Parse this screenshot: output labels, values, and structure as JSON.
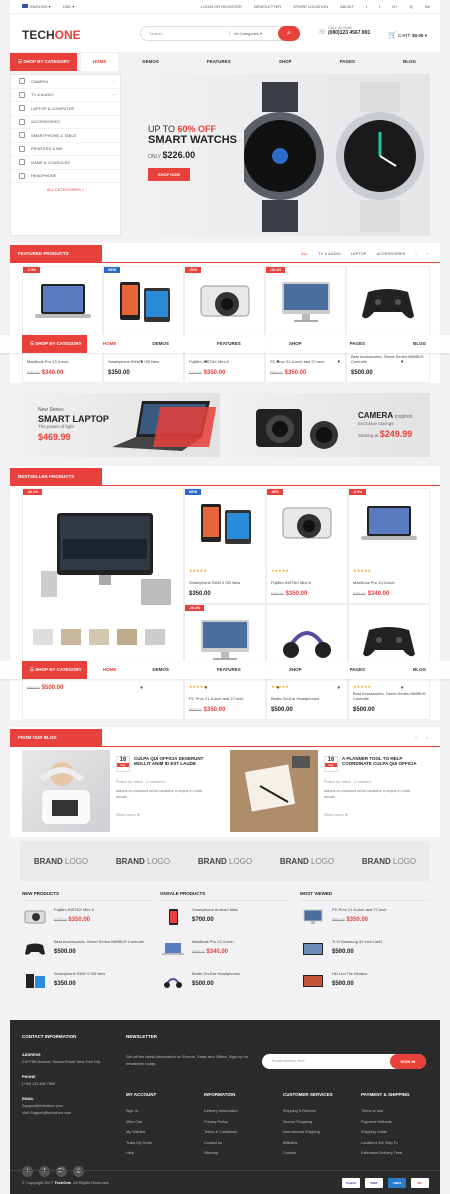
{
  "topbar": {
    "language": "ENGLISH",
    "currency": "USD",
    "links": [
      "LOGIN OR REGISTER",
      "NEWSLETTER",
      "STORE LOCATION",
      "ABOUT"
    ],
    "social_icons": [
      "twitter-icon",
      "facebook-icon",
      "google-plus-icon",
      "dribbble-icon",
      "behance-icon"
    ]
  },
  "header": {
    "logo_a": "TECH",
    "logo_b": "ONE",
    "search_placeholder": "Search...",
    "search_category": "All Categories",
    "call_label": "CALL US NOW",
    "phone": "(080)123 4567 891",
    "cart_label": "CART:",
    "cart_total": "$0.00"
  },
  "nav": {
    "category_label": "SHOP BY CATEGORY",
    "items": [
      "HOME",
      "DEMOS",
      "FEATURES",
      "SHOP",
      "PAGES",
      "BLOG"
    ]
  },
  "categories": [
    "CAMERA",
    "TV & AUDIO",
    "LAPTOP & COMPUTER",
    "ACCESSORIES",
    "SMARTPHONE & TABLE",
    "PRINTERS & INK",
    "GAME & CONSOLES",
    "HEADPHONE"
  ],
  "all_categories": "ALL CATEGORIES",
  "banner": {
    "upto": "UP TO",
    "discount": "60% OFF",
    "title": "SMART WATCHS",
    "only": "ONLY",
    "price": "$226.00",
    "button": "SHOP NOW"
  },
  "featured": {
    "title": "FEATURED PRODUCTS",
    "tabs": [
      "ALL",
      "TV & AUDIO",
      "LAPTOP",
      "ACCESSORIES"
    ],
    "products": [
      {
        "badge": "-2.9%",
        "badge_type": "sale",
        "name": "MacBook Pro 13.3-inch",
        "old": "$350.00",
        "price": "$340.00"
      },
      {
        "badge": "NEW",
        "badge_type": "new",
        "name": "Smartphone RAM 4 GB New",
        "old": "",
        "price": "$350.00"
      },
      {
        "badge": "-50%",
        "badge_type": "sale",
        "name": "Fujifilm INSTAX Mini 8",
        "old": "$700.00",
        "price": "$350.00"
      },
      {
        "badge": "-36.4%",
        "badge_type": "sale",
        "name": "PC Prox 21.5-inch and 27-inch",
        "old": "$550.00",
        "price": "$350.00"
      },
      {
        "badge": "",
        "badge_type": "",
        "name": "Best Accessories- Street Series NIMBUS Controlle",
        "old": "",
        "price": "$500.00"
      }
    ]
  },
  "promos": [
    {
      "sub": "New Series",
      "title": "SMART LAPTOP",
      "tagline": "The power of light",
      "price": "$469.99"
    },
    {
      "title_a": "CAMERA",
      "title_b": "inspiron",
      "tagline": "Exclusive savings",
      "starting": "Starting at",
      "price": "$249.99"
    }
  ],
  "bestseller": {
    "title": "BESTSELLER PRODUCTS",
    "big_badge": "-25.1%",
    "big_old": "$500.00",
    "big_price": "$500.00",
    "products": [
      {
        "badge": "NEW",
        "badge_type": "new",
        "name": "Smartphone RAM 4 GB New",
        "old": "",
        "price": "$350.00"
      },
      {
        "badge": "-50%",
        "badge_type": "sale",
        "name": "Fujifilm INSTAX Mini 8",
        "old": "$700.00",
        "price": "$350.00"
      },
      {
        "badge": "-2.9%",
        "badge_type": "sale",
        "name": "MacBook Pro 13.3-inch",
        "old": "$350.00",
        "price": "$340.00"
      },
      {
        "badge": "-36.4%",
        "badge_type": "sale",
        "name": "PC Prox 21.5-inch and 27-inch",
        "old": "$550.00",
        "price": "$350.00"
      },
      {
        "badge": "",
        "badge_type": "",
        "name": "Beats On-Ear Headphones",
        "old": "",
        "price": "$500.00"
      },
      {
        "badge": "",
        "badge_type": "",
        "name": "Best Accessories- Street Series NIMBUS Controlle",
        "old": "",
        "price": "$500.00"
      }
    ],
    "stars": "★★★★★"
  },
  "blog": {
    "title": "FROM OUR BLOG",
    "posts": [
      {
        "day": "16",
        "month": "Mar",
        "title": "CULPA QUI OFFICIA DESERUNT MOLLIT ANIM ID EST LAUDE",
        "meta": "Posted by: admin",
        "comments": "2 comments",
        "excerpt": "Mauris eu euismod tellus curabitur a neque in nulla iaculis...",
        "more": "Read more"
      },
      {
        "day": "16",
        "month": "Mar",
        "title": "A PLANNER TOOL TO HELP COORDINATE CULPA QUI OFFICIA",
        "meta": "Posted by: admin",
        "comments": "2 comment",
        "excerpt": "Mauris eu euismod tellus curabitur a neque in nulla iaculis...",
        "more": "Read more"
      }
    ]
  },
  "brands": [
    "BRAND",
    "LOGO"
  ],
  "lists": [
    {
      "title": "NEW PRODUCTS",
      "items": [
        {
          "name": "Fujifilm INSTAX Mini 8",
          "old": "$700.00",
          "price": "$350.00"
        },
        {
          "name": "Best Accessories- Street Series NIMBUS Controlle",
          "old": "",
          "price": "$500.00"
        },
        {
          "name": "Smartphone RAM 4 GB New",
          "old": "",
          "price": "$350.00"
        }
      ]
    },
    {
      "title": "ONSALE PRODUCTS",
      "items": [
        {
          "name": "Smartphone Android Nkia",
          "old": "",
          "price": "$700.00"
        },
        {
          "name": "MacBook Pro 13.3-inch",
          "old": "$350.00",
          "price": "$340.00"
        },
        {
          "name": "Beats On-Ear Headphones",
          "old": "",
          "price": "$500.00"
        }
      ]
    },
    {
      "title": "MOST VIEWED",
      "items": [
        {
          "name": "PC Prox 21.5-inch and 27-inch",
          "old": "$550.00",
          "price": "$350.00"
        },
        {
          "name": "Ti Vi Samsung 32 inch Ua32",
          "old": "",
          "price": "$500.00"
        },
        {
          "name": "HD Led Tiis Nimbus",
          "old": "",
          "price": "$500.00"
        }
      ]
    }
  ],
  "footer": {
    "contact_title": "CONTACT INFORMATION",
    "address_label": "ADDRESS",
    "address": "218 Fifth Avenue, HeavenTower New York City",
    "phone_label": "PHONE",
    "phone": "(+99) 123 456 7890",
    "email_label": "EMAIL",
    "email1": "Support@techstore.com",
    "email2": "Visit Support@techstore.com",
    "newsletter_title": "NEWSLETTER",
    "newsletter_text": "Get all the latest information on Events, Sales and Offers. Sign up for newsletter today.",
    "email_placeholder": "Email address here",
    "signin": "SIGN IN",
    "cols": [
      {
        "title": "MY ACCOUNT",
        "links": [
          "Sign In",
          "View Cart",
          "My Wishlist",
          "Track My Order",
          "Help"
        ]
      },
      {
        "title": "INFORMATION",
        "links": [
          "Delivery Information",
          "Privacy Policy",
          "Terms & Conditions",
          "Contact us",
          "Sitemap"
        ]
      },
      {
        "title": "CUSTOMER SERVICES",
        "links": [
          "Shipping & Returns",
          "Secure Shopping",
          "International Shipping",
          "Affiliates",
          "Contact"
        ]
      },
      {
        "title": "PAYMENT & SHIPPING",
        "links": [
          "Terms of Use",
          "Payment Methods",
          "Shipping Guide",
          "Locations We Ship To",
          "Estimated Delivery Time"
        ]
      }
    ],
    "copyright_a": "© Copyright 2017",
    "copyright_b": "TechOne",
    "copyright_c": ". All Rights Reserved.",
    "payments": [
      "PayPal",
      "VISA",
      "AMEX",
      "MC"
    ]
  }
}
